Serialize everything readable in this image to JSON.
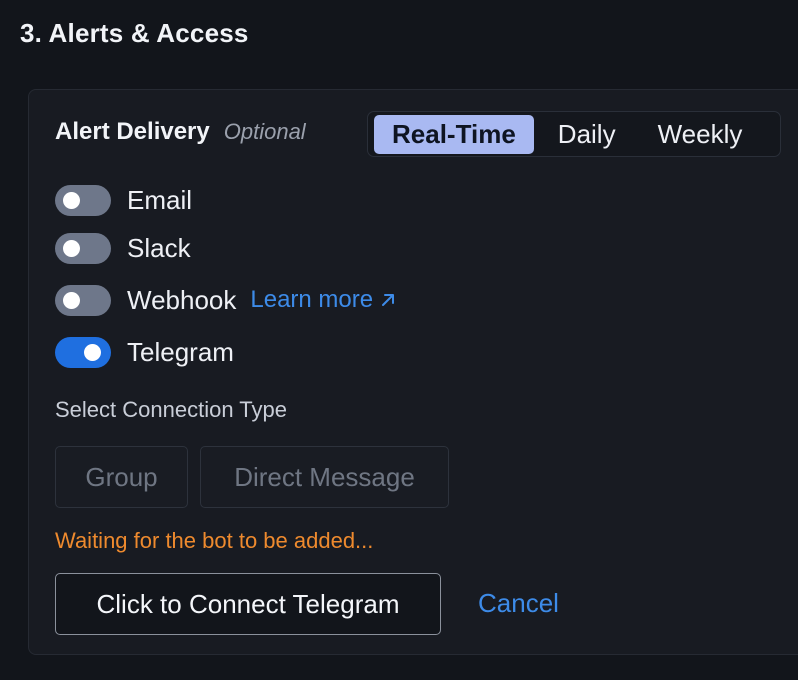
{
  "section": {
    "title": "3. Alerts & Access"
  },
  "delivery": {
    "label": "Alert Delivery",
    "optional": "Optional",
    "frequency_options": [
      "Real-Time",
      "Daily",
      "Weekly"
    ],
    "selected_frequency": "Real-Time"
  },
  "channels": [
    {
      "label": "Email",
      "enabled": false
    },
    {
      "label": "Slack",
      "enabled": false
    },
    {
      "label": "Webhook",
      "enabled": false
    },
    {
      "label": "Telegram",
      "enabled": true
    }
  ],
  "webhook_link": {
    "label": "Learn more",
    "icon": "external-arrow-icon"
  },
  "connection": {
    "label": "Select Connection Type",
    "options": [
      "Group",
      "Direct Message"
    ]
  },
  "status": {
    "waiting_text": "Waiting for the bot to be added..."
  },
  "actions": {
    "connect_label": "Click to Connect Telegram",
    "cancel_label": "Cancel"
  },
  "colors": {
    "accent": "#1f6fe0",
    "link": "#3d8be8",
    "warning": "#ee8a2e",
    "segment_active": "#a9b9f2"
  }
}
